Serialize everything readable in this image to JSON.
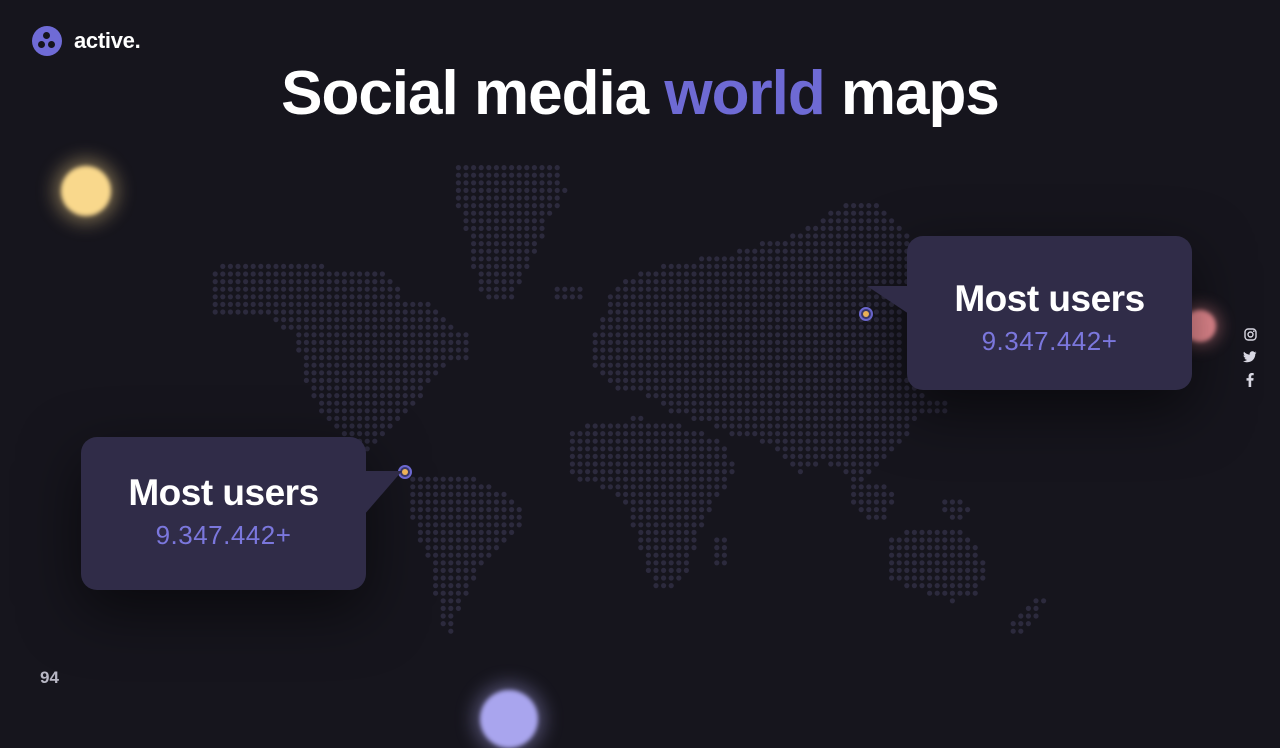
{
  "brand": {
    "name": "active.",
    "accent": "#6f6bd6"
  },
  "title": {
    "before": "Social media ",
    "highlight": "world",
    "after": " maps"
  },
  "callouts": [
    {
      "heading": "Most users",
      "value": "9.347.442+"
    },
    {
      "heading": "Most users",
      "value": "9.347.442+"
    }
  ],
  "social": {
    "icons": [
      "instagram-icon",
      "twitter-icon",
      "facebook-icon"
    ]
  },
  "page_number": "94",
  "colors": {
    "background": "#16151d",
    "map_dot": "#2c2a3d",
    "card": "#302c48",
    "highlight": "#6e6ad4",
    "value": "#7b77dd"
  }
}
